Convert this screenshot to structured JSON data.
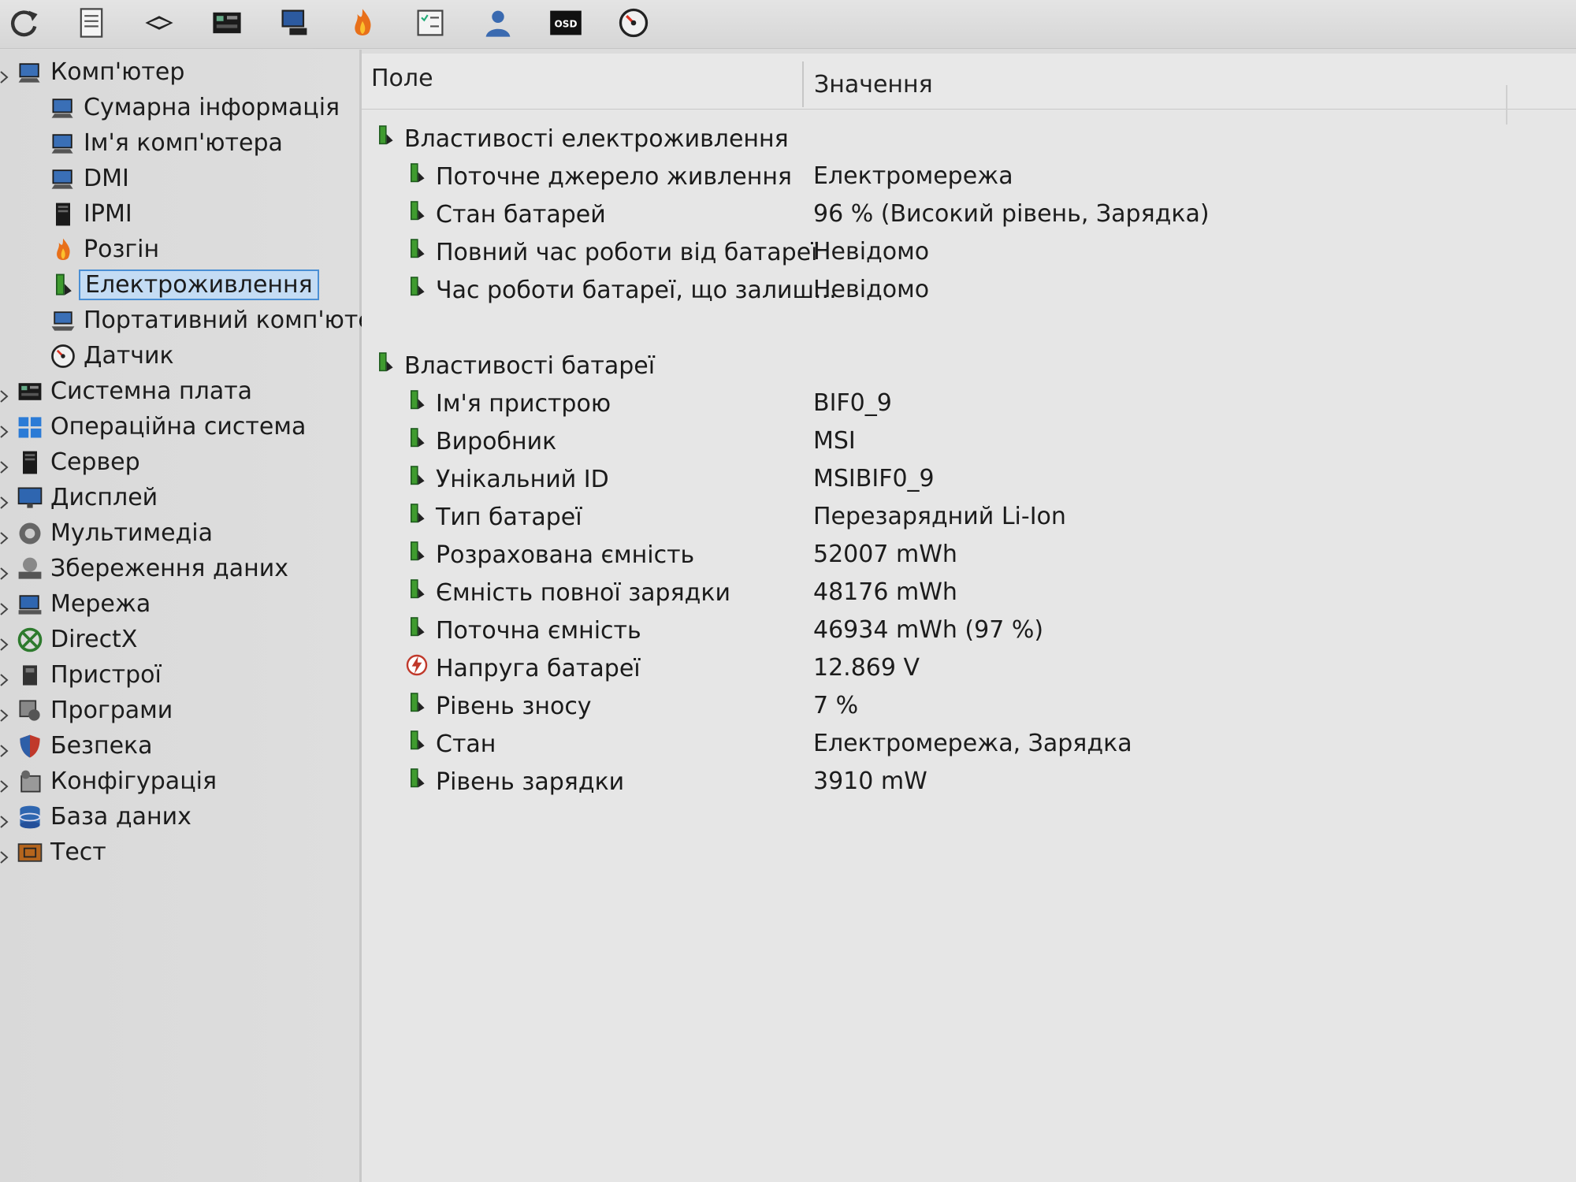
{
  "toolbar": {
    "icons": [
      "refresh-icon",
      "report-icon",
      "hardware-chip-icon",
      "motherboard-icon",
      "network-computer-icon",
      "flame-icon",
      "checklist-icon",
      "user-icon",
      "osd-icon",
      "sensor-gauge-icon"
    ],
    "osd_label": "OSD"
  },
  "sidebar": {
    "items": [
      {
        "label": "Комп'ютер",
        "icon": "computer-icon",
        "level": 0,
        "expander": true
      },
      {
        "label": "Сумарна інформація",
        "icon": "computer-icon",
        "level": 1
      },
      {
        "label": "Ім'я комп'ютера",
        "icon": "computer-icon",
        "level": 1
      },
      {
        "label": "DMI",
        "icon": "computer-icon",
        "level": 1
      },
      {
        "label": "IPMI",
        "icon": "server-icon",
        "level": 1
      },
      {
        "label": "Розгін",
        "icon": "flame-icon",
        "level": 1
      },
      {
        "label": "Електроживлення",
        "icon": "battery-icon",
        "level": 1,
        "selected": true
      },
      {
        "label": "Портативний комп'юте",
        "icon": "laptop-icon",
        "level": 1
      },
      {
        "label": "Датчик",
        "icon": "sensor-gauge-icon",
        "level": 1
      },
      {
        "label": "Системна плата",
        "icon": "motherboard-icon",
        "level": 0,
        "expander": true
      },
      {
        "label": "Операційна система",
        "icon": "windows-icon",
        "level": 0,
        "expander": true
      },
      {
        "label": "Сервер",
        "icon": "server-icon",
        "level": 0,
        "expander": true
      },
      {
        "label": "Дисплей",
        "icon": "display-icon",
        "level": 0,
        "expander": true
      },
      {
        "label": "Мультимедіа",
        "icon": "multimedia-icon",
        "level": 0,
        "expander": true
      },
      {
        "label": "Збереження даних",
        "icon": "storage-icon",
        "level": 0,
        "expander": true
      },
      {
        "label": "Мережа",
        "icon": "network-icon",
        "level": 0,
        "expander": true
      },
      {
        "label": "DirectX",
        "icon": "xbox-icon",
        "level": 0,
        "expander": true
      },
      {
        "label": "Пристрої",
        "icon": "devices-icon",
        "level": 0,
        "expander": true
      },
      {
        "label": "Програми",
        "icon": "programs-icon",
        "level": 0,
        "expander": true
      },
      {
        "label": "Безпека",
        "icon": "shield-icon",
        "level": 0,
        "expander": true
      },
      {
        "label": "Конфігурація",
        "icon": "config-icon",
        "level": 0,
        "expander": true
      },
      {
        "label": "База даних",
        "icon": "database-icon",
        "level": 0,
        "expander": true
      },
      {
        "label": "Тест",
        "icon": "test-icon",
        "level": 0,
        "expander": true
      }
    ]
  },
  "main": {
    "col_field": "Поле",
    "col_value": "Значення",
    "sections": [
      {
        "title": "Властивості електроживлення",
        "rows": [
          {
            "field": "Поточне джерело живлення",
            "value": "Електромережа",
            "icon": "battery-icon"
          },
          {
            "field": "Стан батарей",
            "value": "96 % (Високий рівень, Зарядка)",
            "icon": "battery-icon"
          },
          {
            "field": "Повний час роботи від батареї",
            "value": "Невідомо",
            "icon": "battery-icon"
          },
          {
            "field": "Час роботи батареї, що залиш...",
            "value": "Невідомо",
            "icon": "battery-icon"
          }
        ]
      },
      {
        "title": "Властивості батареї",
        "rows": [
          {
            "field": "Ім'я пристрою",
            "value": "BIF0_9",
            "icon": "battery-icon"
          },
          {
            "field": "Виробник",
            "value": "MSI",
            "icon": "battery-icon"
          },
          {
            "field": "Унікальний ID",
            "value": "MSIBIF0_9",
            "icon": "battery-icon"
          },
          {
            "field": "Тип батареї",
            "value": "Перезарядний Li-Ion",
            "icon": "battery-icon"
          },
          {
            "field": "Розрахована ємність",
            "value": "52007 mWh",
            "icon": "battery-icon"
          },
          {
            "field": "Ємність повної зарядки",
            "value": "48176 mWh",
            "icon": "battery-icon"
          },
          {
            "field": "Поточна ємність",
            "value": "46934 mWh  (97 %)",
            "icon": "battery-icon"
          },
          {
            "field": "Напруга батареї",
            "value": "12.869 V",
            "icon": "voltage-icon"
          },
          {
            "field": "Рівень зносу",
            "value": "7 %",
            "icon": "battery-icon"
          },
          {
            "field": "Стан",
            "value": "Електромережа, Зарядка",
            "icon": "battery-icon"
          },
          {
            "field": "Рівень зарядки",
            "value": "3910 mW",
            "icon": "battery-icon"
          }
        ]
      }
    ]
  }
}
